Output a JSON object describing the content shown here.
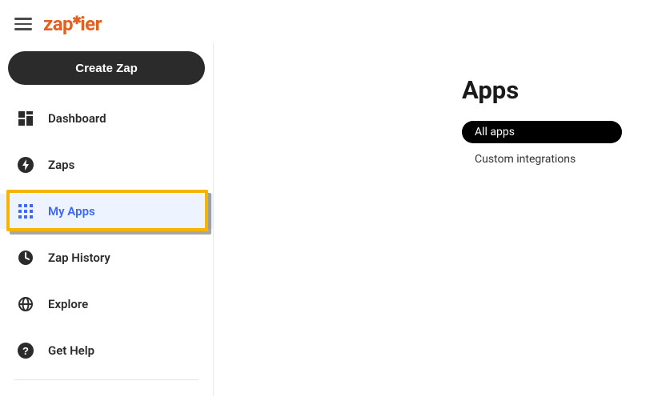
{
  "brand": {
    "name": "zapier"
  },
  "sidebar": {
    "create_label": "Create Zap",
    "items": [
      {
        "label": "Dashboard"
      },
      {
        "label": "Zaps"
      },
      {
        "label": "My Apps"
      },
      {
        "label": "Zap History"
      },
      {
        "label": "Explore"
      },
      {
        "label": "Get Help"
      }
    ]
  },
  "main": {
    "title": "Apps",
    "filters": {
      "all": "All apps",
      "custom": "Custom integrations"
    }
  }
}
